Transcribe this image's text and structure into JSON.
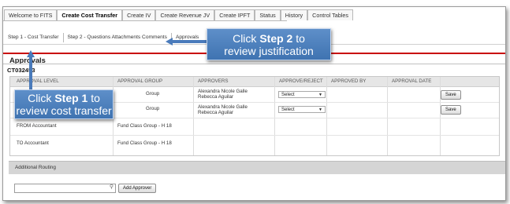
{
  "nav": {
    "tabs": [
      "Welcome to FITS",
      "Create Cost Transfer",
      "Create IV",
      "Create Revenue JV",
      "Create IPFT",
      "Status",
      "History",
      "Control Tables"
    ],
    "active": "Create Cost Transfer"
  },
  "steps": {
    "tabs": [
      "Step 1 - Cost Transfer",
      "Step 2 - Questions Attachments Comments",
      "Approvals"
    ]
  },
  "section": {
    "title": "Approvals",
    "id": "CT032453"
  },
  "table": {
    "headers": [
      "APPROVAL LEVEL",
      "APPROVAL GROUP",
      "APPROVERS",
      "APPROVE/REJECT",
      "APPROVED BY",
      "APPROVAL DATE"
    ],
    "rows": [
      {
        "level": "",
        "group": "Group",
        "approver1": "Alexandra Nicole Galle",
        "approver2": "Rebecca Aguilar",
        "select": "Select",
        "button": "Save"
      },
      {
        "level": "",
        "group": "Group",
        "approver1": "Alexandra Nicole Galle",
        "approver2": "Rebecca Aguilar",
        "select": "Select",
        "button": "Save"
      },
      {
        "level": "FROM Accountant",
        "group": "Fund Class Group - H 18",
        "approver1": "",
        "approver2": "",
        "select": "",
        "button": ""
      },
      {
        "level": "TO Accountant",
        "group": "Fund Class Group - H 18",
        "approver1": "",
        "approver2": "",
        "select": "",
        "button": ""
      }
    ]
  },
  "routing": {
    "label": "Additional Routing",
    "input_value": "",
    "add_button": "Add Approver"
  },
  "callouts": {
    "step1": {
      "prefix": "Click ",
      "bold": "Step 1",
      "suffix": " to",
      "line2": "review cost transfer"
    },
    "step2": {
      "prefix": "Click ",
      "bold": "Step 2",
      "suffix": " to",
      "line2": "review justification"
    }
  },
  "colors": {
    "accent_red": "#c80000",
    "callout_blue": "#4a7bbb"
  }
}
